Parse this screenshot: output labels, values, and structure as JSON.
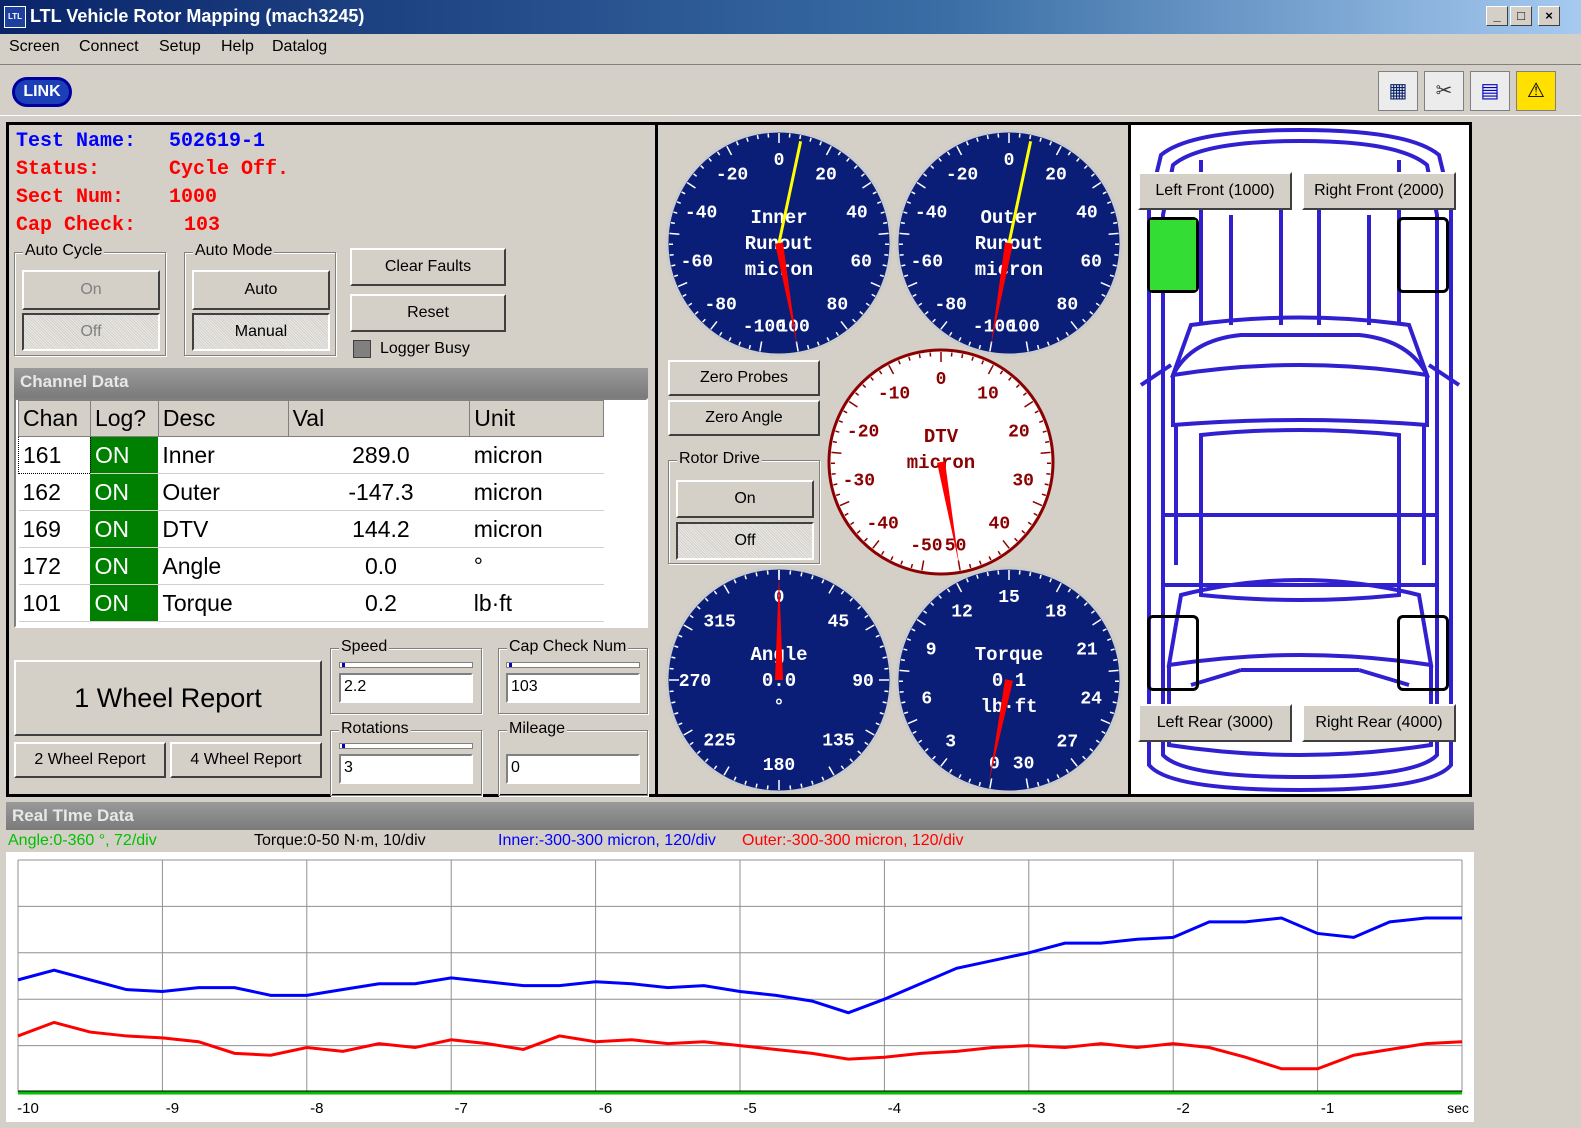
{
  "window": {
    "title": "LTL Vehicle Rotor Mapping (mach3245)",
    "minimize": "_",
    "maximize": "□",
    "close": "×"
  },
  "menu": [
    "Screen",
    "Connect",
    "Setup",
    "Help",
    "Datalog"
  ],
  "toolbar": {
    "link_label": "LINK",
    "icons": [
      "link-status-icon",
      "tools-icon",
      "document-icon",
      "warning-icon"
    ]
  },
  "test_info": {
    "name_label": "Test Name:",
    "name_value": "502619-1",
    "status_label": "Status:",
    "status_value": "Cycle Off.",
    "sect_label": "Sect Num:",
    "sect_value": "1000",
    "cap_label": "Cap Check:",
    "cap_value": "103"
  },
  "auto_cycle": {
    "label": "Auto Cycle",
    "on": "On",
    "off": "Off"
  },
  "auto_mode": {
    "label": "Auto Mode",
    "auto": "Auto",
    "manual": "Manual"
  },
  "buttons": {
    "clear_faults": "Clear Faults",
    "reset": "Reset",
    "logger_busy": "Logger Busy",
    "one_wheel": "1 Wheel Report",
    "two_wheel": "2 Wheel Report",
    "four_wheel": "4 Wheel Report",
    "zero_probes": "Zero Probes",
    "zero_angle": "Zero Angle"
  },
  "channel_data": {
    "title": "Channel Data",
    "columns": [
      "Chan",
      "Log?",
      "Desc",
      "Val",
      "Unit"
    ],
    "rows": [
      [
        "161",
        "ON",
        "Inner",
        "289.0",
        "micron"
      ],
      [
        "162",
        "ON",
        "Outer",
        "-147.3",
        "micron"
      ],
      [
        "169",
        "ON",
        "DTV",
        "144.2",
        "micron"
      ],
      [
        "172",
        "ON",
        "Angle",
        "0.0",
        "°"
      ],
      [
        "101",
        "ON",
        "Torque",
        "0.2",
        "lb·ft"
      ]
    ]
  },
  "fields": {
    "speed": {
      "label": "Speed",
      "value": "2.2"
    },
    "cap_check_num": {
      "label": "Cap Check Num",
      "value": "103"
    },
    "rotations": {
      "label": "Rotations",
      "value": "3"
    },
    "mileage": {
      "label": "Mileage",
      "value": "0"
    }
  },
  "rotor_drive": {
    "label": "Rotor Drive",
    "on": "On",
    "off": "Off"
  },
  "gauges": {
    "inner": {
      "title1": "Inner",
      "title2": "Runout",
      "title3": "micron",
      "ticks": [
        "-100",
        "-80",
        "-60",
        "-40",
        "-20",
        "0",
        "20",
        "40",
        "60",
        "80",
        "100"
      ],
      "value": 289.0
    },
    "outer": {
      "title1": "Outer",
      "title2": "Runout",
      "title3": "micron",
      "ticks": [
        "-100",
        "-80",
        "-60",
        "-40",
        "-20",
        "0",
        "20",
        "40",
        "60",
        "80",
        "100"
      ],
      "value": -147.3
    },
    "dtv": {
      "title1": "DTV",
      "title2": "micron",
      "ticks": [
        "-50",
        "-40",
        "-30",
        "-20",
        "-10",
        "0",
        "10",
        "20",
        "30",
        "40",
        "50"
      ],
      "value": 144.2
    },
    "angle": {
      "title1": "Angle",
      "title2": "0.0",
      "title3": "°",
      "ticks": [
        "0",
        "45",
        "90",
        "135",
        "180",
        "225",
        "270",
        "315"
      ],
      "value": 0.0
    },
    "torque": {
      "title1": "Torque",
      "title2": "0.1",
      "title3": "lb·ft",
      "ticks": [
        "0",
        "3",
        "6",
        "9",
        "12",
        "15",
        "18",
        "21",
        "24",
        "27",
        "30"
      ],
      "value": 0.1
    }
  },
  "wheels": {
    "lf": "Left Front (1000)",
    "rf": "Right Front (2000)",
    "lr": "Left Rear (3000)",
    "rr": "Right Rear (4000)",
    "active_color": "#33dd33"
  },
  "realtime": {
    "title": "Real TIme Data",
    "legend_angle": "Angle:0-360 °, 72/div",
    "legend_torque": "Torque:0-50 N·m, 10/div",
    "legend_inner": "Inner:-300-300 micron, 120/div",
    "legend_outer": "Outer:-300-300 micron, 120/div",
    "x_ticks": [
      "-10",
      "-9",
      "-8",
      "-7",
      "-6",
      "-5",
      "-4",
      "-3",
      "-2",
      "-1"
    ],
    "x_unit": "sec"
  },
  "chart_data": {
    "type": "line",
    "x": [
      -10,
      -9.75,
      -9.5,
      -9.25,
      -9,
      -8.75,
      -8.5,
      -8.25,
      -8,
      -7.75,
      -7.5,
      -7.25,
      -7,
      -6.75,
      -6.5,
      -6.25,
      -6,
      -5.75,
      -5.5,
      -5.25,
      -5,
      -4.75,
      -4.5,
      -4.25,
      -4,
      -3.75,
      -3.5,
      -3.25,
      -3,
      -2.75,
      -2.5,
      -2.25,
      -2,
      -1.75,
      -1.5,
      -1.25,
      -1,
      -0.75,
      -0.5,
      -0.25,
      0
    ],
    "series": [
      {
        "name": "Inner:-300-300 micron, 120/div",
        "color": "#0000ff",
        "values": [
          -10,
          15,
          -10,
          -35,
          -40,
          -30,
          -30,
          -50,
          -50,
          -35,
          -20,
          -20,
          -5,
          -15,
          -25,
          -25,
          -15,
          -20,
          -30,
          -25,
          -40,
          -50,
          -65,
          -95,
          -60,
          -20,
          20,
          40,
          60,
          85,
          85,
          95,
          100,
          140,
          140,
          150,
          110,
          100,
          140,
          150,
          150
        ]
      },
      {
        "name": "Outer:-300-300 micron, 120/div",
        "color": "#ff0000",
        "values": [
          -155,
          -120,
          -145,
          -155,
          -160,
          -170,
          -200,
          -205,
          -185,
          -195,
          -175,
          -185,
          -165,
          -175,
          -190,
          -155,
          -170,
          -165,
          -175,
          -170,
          -180,
          -190,
          -200,
          -215,
          -210,
          -200,
          -195,
          -185,
          -180,
          -185,
          -175,
          -185,
          -175,
          -185,
          -210,
          -240,
          -240,
          -205,
          -190,
          -175,
          -170
        ]
      },
      {
        "name": "Torque:0-50 N·m, 10/div",
        "color": "#000000",
        "values": [
          0,
          0,
          0,
          0,
          0,
          0,
          0,
          0,
          0,
          0,
          0,
          0,
          0,
          0,
          0,
          0,
          0,
          0,
          0,
          0,
          0,
          0,
          0,
          0,
          0,
          0,
          0,
          0,
          0,
          0,
          0,
          0,
          0,
          0,
          0,
          0,
          0,
          0,
          0,
          0,
          0
        ]
      },
      {
        "name": "Angle:0-360 °, 72/div",
        "color": "#00c000",
        "values": [
          0,
          0,
          0,
          0,
          0,
          0,
          0,
          0,
          0,
          0,
          0,
          0,
          0,
          0,
          0,
          0,
          0,
          0,
          0,
          0,
          0,
          0,
          0,
          0,
          0,
          0,
          0,
          0,
          0,
          0,
          0,
          0,
          0,
          0,
          0,
          0,
          0,
          0,
          0,
          0,
          0
        ]
      }
    ],
    "xlim": [
      -10,
      0
    ],
    "ylim": [
      -300,
      300
    ],
    "grid": true
  }
}
